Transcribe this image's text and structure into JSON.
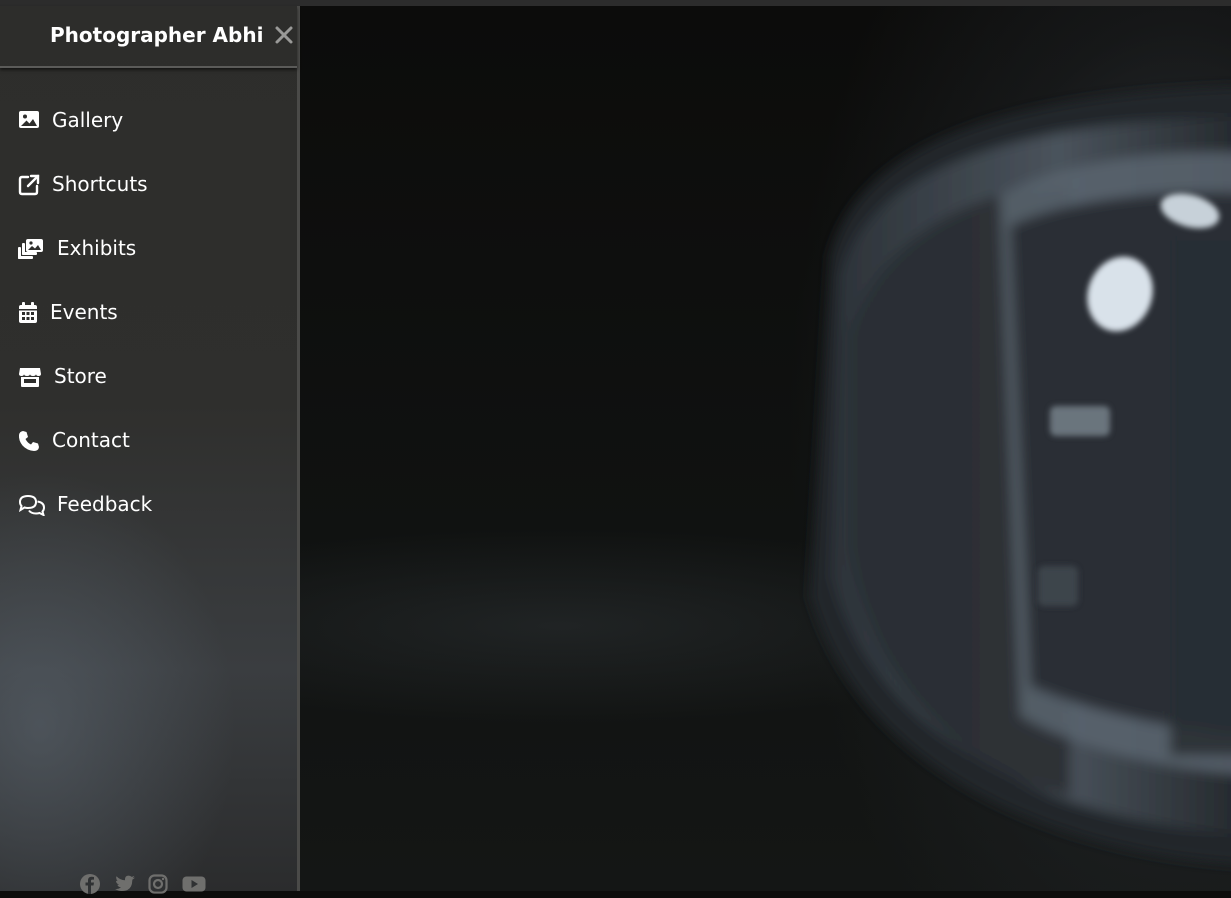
{
  "sidebar": {
    "title": "Photographer Abhi",
    "close_icon": "close-icon",
    "items": [
      {
        "label": "Gallery",
        "icon": "image-icon"
      },
      {
        "label": "Shortcuts",
        "icon": "external-link-icon"
      },
      {
        "label": "Exhibits",
        "icon": "photo-stack-icon"
      },
      {
        "label": "Events",
        "icon": "calendar-icon"
      },
      {
        "label": "Store",
        "icon": "store-icon"
      },
      {
        "label": "Contact",
        "icon": "phone-icon"
      },
      {
        "label": "Feedback",
        "icon": "chat-bubbles-icon"
      }
    ],
    "social_icons": [
      "facebook-icon",
      "twitter-icon",
      "instagram-icon",
      "youtube-icon"
    ]
  },
  "colors": {
    "sidebar_bg": "#2d2d2b",
    "text": "#ffffff",
    "close_icon": "#9a9a98",
    "social_icon": "#6f6f6d"
  }
}
